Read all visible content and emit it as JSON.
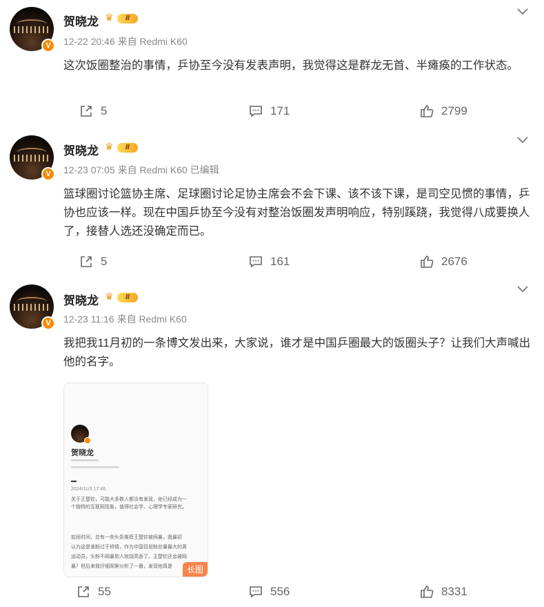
{
  "colors": {
    "accent": "#f78b05",
    "text": "#333333",
    "meta": "#888888",
    "action": "#666666"
  },
  "posts": [
    {
      "author": "贺晓龙",
      "level_badge": "Ⅱ",
      "verified_badge": "V",
      "timestamp": "12-22 20:46",
      "source": "来自 Redmi K60",
      "edited": "",
      "content": "这次饭圈整治的事情，乒协至今没有发表声明，我觉得这是群龙无首、半瘫痪的工作状态。",
      "reposts": "5",
      "comments": "171",
      "likes": "2799"
    },
    {
      "author": "贺晓龙",
      "level_badge": "Ⅱ",
      "verified_badge": "V",
      "timestamp": "12-23 07:05",
      "source": "来自 Redmi K60",
      "edited": "已编辑",
      "content": "篮球圈讨论篮协主席、足球圈讨论足协主席会不会下课、该不该下课，是司空见惯的事情，乒协也应该一样。现在中国乒协至今没有对整治饭圈发声明响应，特别蹊跷，我觉得八成要换人了，接替人选还没确定而已。",
      "reposts": "5",
      "comments": "161",
      "likes": "2676"
    },
    {
      "author": "贺晓龙",
      "level_badge": "Ⅱ",
      "verified_badge": "V",
      "timestamp": "12-23 11:16",
      "source": "来自 Redmi K60",
      "edited": "",
      "content": "我把我11月初的一条博文发出来，大家说，谁才是中国乒圈最大的饭圈头子？让我们大声喊出他的名字。",
      "reposts": "55",
      "comments": "556",
      "likes": "8331",
      "image": {
        "name": "贺晓龙",
        "date": "2024/11/3 17:46",
        "para1_l1": "关于王楚钦，可能大多数人都没有发现，他已经成为一",
        "para1_l2": "个独特的互联网现象，值得社会学、心理学专家研究。",
        "para2_l1": "前段时间，总有一些头条推荐王楚钦被网暴，我最初",
        "para2_l2": "认为这是谁粉过于矫情，作为中国目前粉丝量最大的男",
        "para2_l3": "运动员，头粉不网暴到人就烧高香了，主楚钦还会被网",
        "para2_l4": "暴？但后来我仔细观察分析了一番，发现他真是",
        "tag": "长图"
      }
    }
  ],
  "icons": [
    "repost-icon",
    "comment-icon",
    "like-icon",
    "chevron-down-icon",
    "crown-icon",
    "verified-icon"
  ]
}
